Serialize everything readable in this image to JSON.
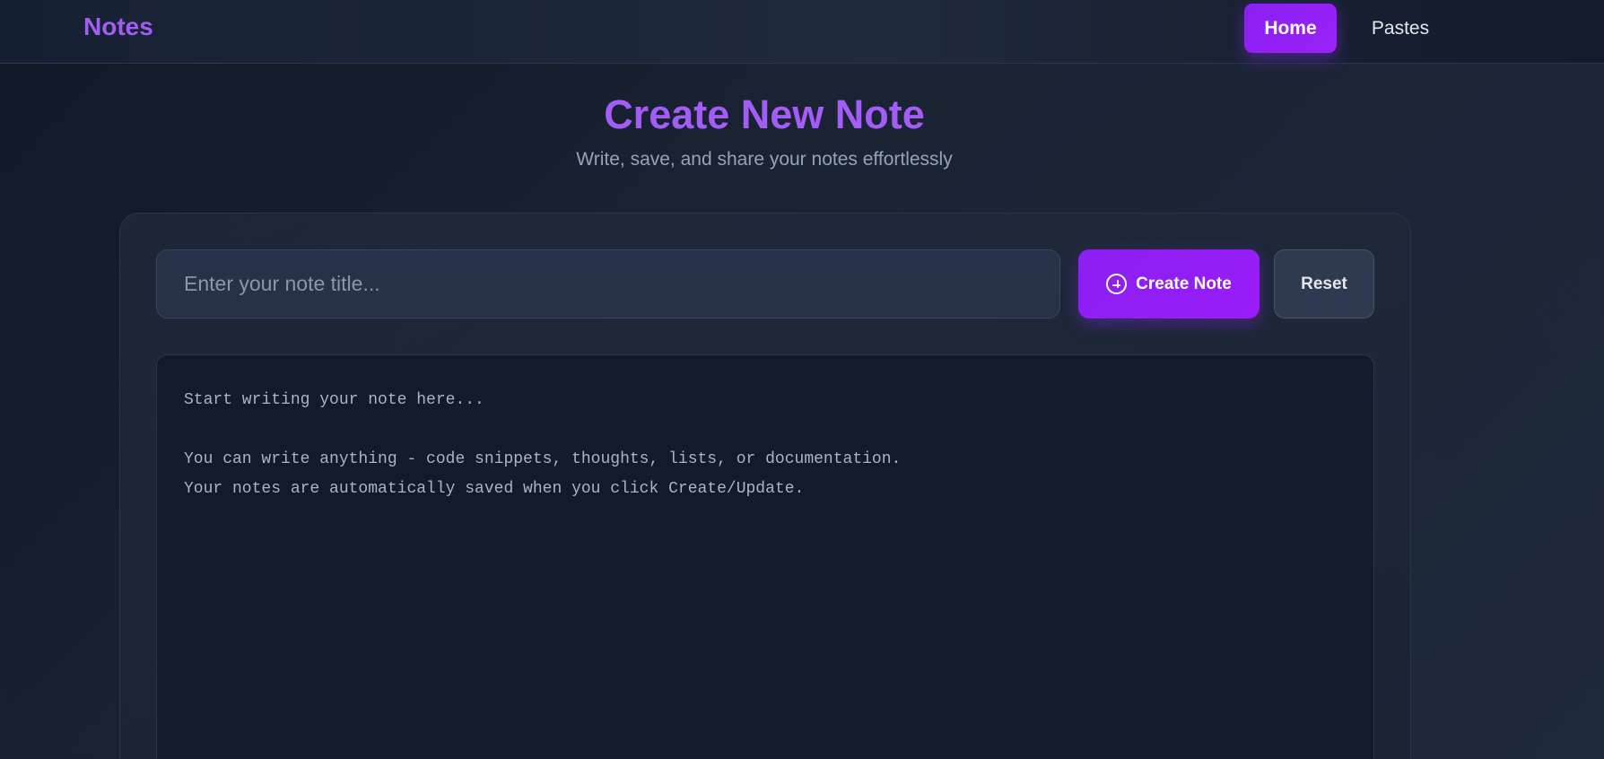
{
  "navbar": {
    "brand": "Notes",
    "links": [
      {
        "label": "Home",
        "active": true
      },
      {
        "label": "Pastes",
        "active": false
      }
    ]
  },
  "header": {
    "title": "Create New Note",
    "subtitle": "Write, save, and share your notes effortlessly"
  },
  "form": {
    "title_placeholder": "Enter your note title...",
    "title_value": "",
    "create_button_label": "Create Note",
    "create_button_icon": "plus-circle-icon",
    "reset_button_label": "Reset",
    "content_placeholder": "Start writing your note here...\n\nYou can write anything - code snippets, thoughts, lists, or documentation.\nYour notes are automatically saved when you click Create/Update."
  },
  "colors": {
    "accent": "#9b1ff7",
    "brand_text": "#a35df6",
    "background": "#111827",
    "card": "#1e293b"
  }
}
